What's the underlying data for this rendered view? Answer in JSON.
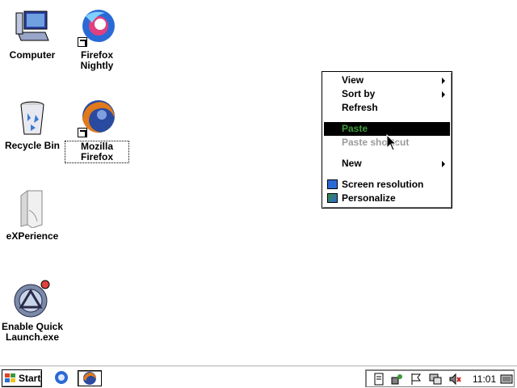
{
  "desktop": {
    "icons": [
      {
        "label": "Computer"
      },
      {
        "label": "Firefox Nightly"
      },
      {
        "label": "Recycle Bin"
      },
      {
        "label": "Mozilla Firefox"
      },
      {
        "label": "eXPerience"
      },
      {
        "label": "Enable Quick Launch.exe"
      }
    ]
  },
  "context_menu": {
    "items": {
      "view": "View",
      "sort_by": "Sort by",
      "refresh": "Refresh",
      "paste": "Paste",
      "paste_shortcut": "Paste shortcut",
      "new": "New",
      "screen_resolution": "Screen resolution",
      "personalize": "Personalize"
    }
  },
  "taskbar": {
    "start_label": "Start",
    "clock": "11:01"
  },
  "colors": {
    "highlight_bg": "#000000",
    "highlight_text": "#3c9c3c",
    "disabled_text": "#9a9a9a"
  }
}
